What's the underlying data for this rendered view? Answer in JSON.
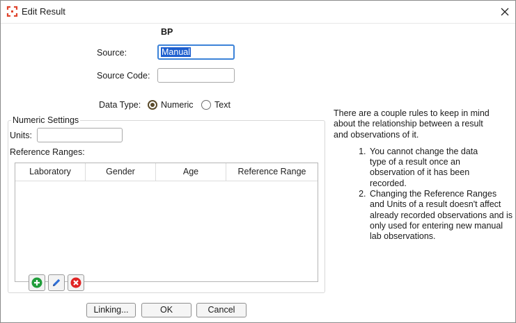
{
  "window": {
    "title": "Edit Result",
    "app_icon": "app-logo-icon",
    "close_icon": "close-icon"
  },
  "form": {
    "heading": "BP",
    "source_label": "Source:",
    "source_value": "Manual",
    "source_code_label": "Source Code:",
    "source_code_value": "",
    "data_type_label": "Data Type:",
    "data_type_options": [
      "Numeric",
      "Text"
    ],
    "data_type_selected": "Numeric"
  },
  "numeric_settings": {
    "title": "Numeric Settings",
    "units_label": "Units:",
    "units_value": "",
    "ranges_label": "Reference Ranges:",
    "columns": [
      "Laboratory",
      "Gender",
      "Age",
      "Reference Range"
    ],
    "rows": [],
    "toolbar_icons": [
      "add-icon",
      "edit-pencil-icon",
      "delete-icon"
    ]
  },
  "help": {
    "intro": "There are a couple rules to keep in mind about the relationship between a result and observations of it.",
    "rules": [
      "You cannot change the data type of a result once an observation of it has been recorded.",
      "Changing the Reference Ranges and Units of a result doesn't affect already recorded observations and is only used for entering new manual lab observations."
    ]
  },
  "buttons": {
    "linking": "Linking...",
    "ok": "OK",
    "cancel": "Cancel"
  },
  "colors": {
    "accent": "#3b82d8",
    "add": "#1f9d3a",
    "edit": "#2f6fd6",
    "delete": "#e02424",
    "logo": "#e0452e"
  }
}
